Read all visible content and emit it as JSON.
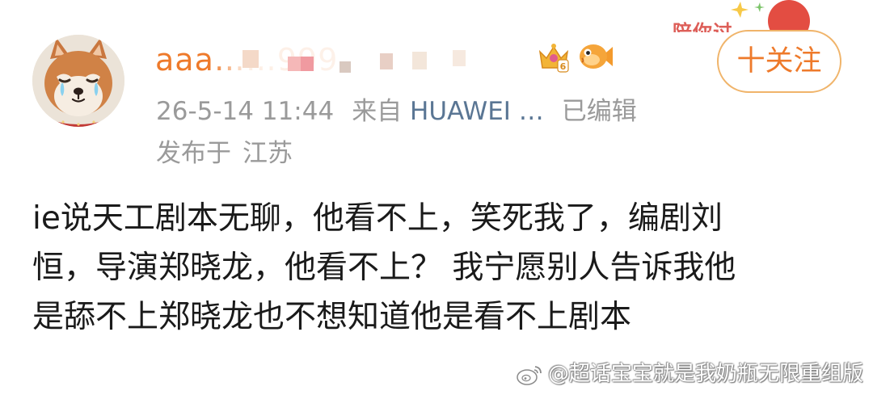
{
  "header": {
    "username": "aaa……999",
    "follow_label": "十关注",
    "timestamp": "26-5-14 11:44",
    "source_prefix": "来自",
    "device": "HUAWEI …",
    "edited_label": "已编辑",
    "location_prefix": "发布于",
    "location": "江苏",
    "promo_text": "陪你过",
    "level_badge": "6"
  },
  "post": {
    "lines": [
      "ie说天工剧本无聊，他看不上，笑死我了，编剧刘",
      "恒，导演郑晓龙，他看不上？ 我宁愿别人告诉我他",
      "是舔不上郑晓龙也不想知道他是看不上剧本"
    ]
  },
  "watermark": {
    "text": "@超话宝宝就是我奶瓶无限重组版"
  },
  "icons": {
    "avatar": "shiba-dog-avatar",
    "crown": "crown-level-icon",
    "fish": "pufferfish-icon",
    "weibo": "weibo-logo-icon"
  },
  "colors": {
    "username": "#ee7a2b",
    "meta": "#9a9a9a",
    "device": "#5a7694",
    "follow_border": "#f0b46a",
    "body_text": "#1a1a1a"
  }
}
